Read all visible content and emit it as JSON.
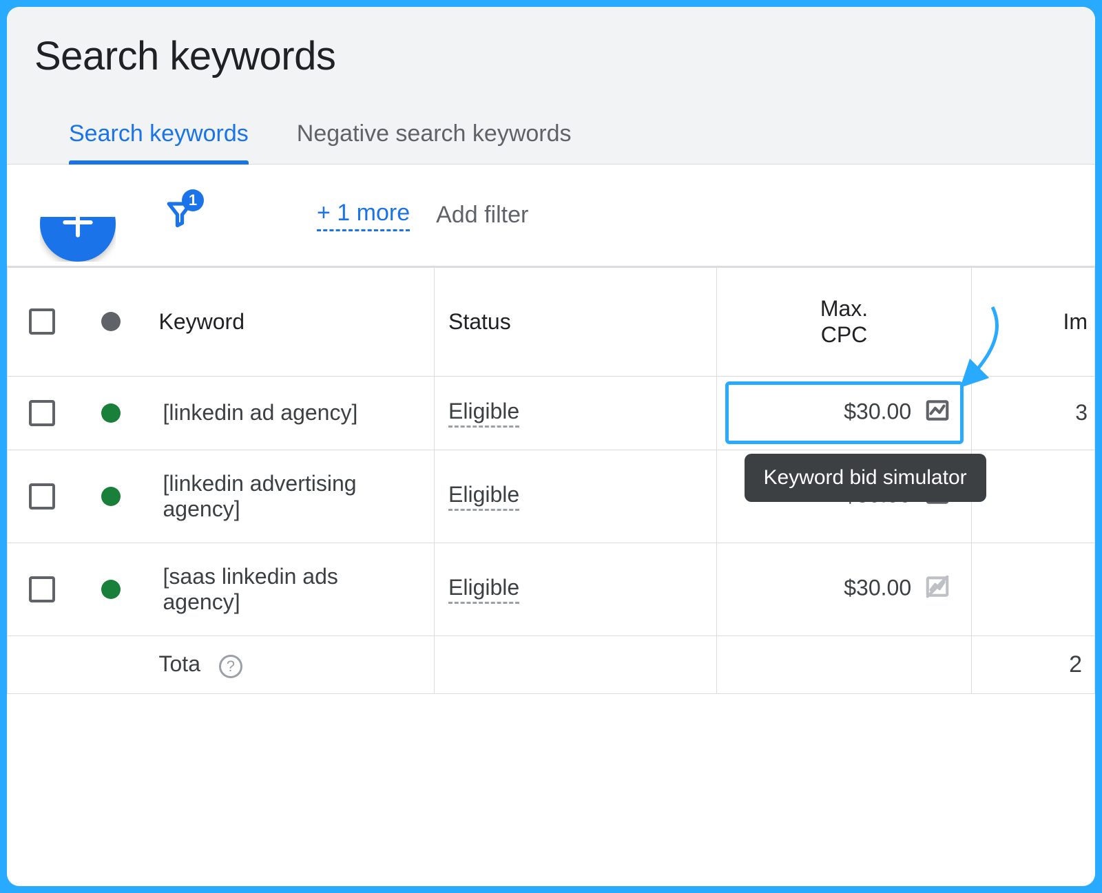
{
  "page_title": "Search keywords",
  "tabs": [
    {
      "label": "Search keywords",
      "active": true
    },
    {
      "label": "Negative search keywords",
      "active": false
    }
  ],
  "filter_bar": {
    "badge_count": "1",
    "more_link": "+ 1 more",
    "add_filter": "Add filter"
  },
  "columns": {
    "keyword": "Keyword",
    "status": "Status",
    "max_cpc_line1": "Max.",
    "max_cpc_line2": "CPC",
    "impr": "Im"
  },
  "rows": [
    {
      "keyword": "[linkedin ad agency]",
      "status": "Eligible",
      "cpc": "$30.00",
      "impr": "3",
      "sim_enabled": true,
      "highlighted": true
    },
    {
      "keyword": "[linkedin advertising agency]",
      "status": "Eligible",
      "cpc": "$30.00",
      "impr": "",
      "sim_enabled": true,
      "highlighted": false
    },
    {
      "keyword": "[saas linkedin ads agency]",
      "status": "Eligible",
      "cpc": "$30.00",
      "impr": "",
      "sim_enabled": false,
      "highlighted": false
    }
  ],
  "footer": {
    "total_label": "Tota",
    "right_value": "2"
  },
  "tooltip": "Keyword bid simulator",
  "colors": {
    "accent": "#1a73e8",
    "annotation": "#27aaff",
    "green": "#188038"
  }
}
